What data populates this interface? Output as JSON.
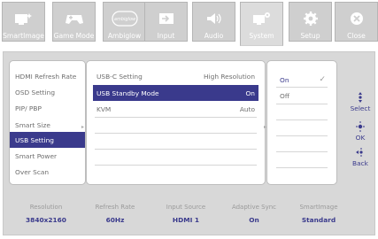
{
  "tabs": [
    {
      "label": "SmartImage",
      "icon": "smartimage-icon"
    },
    {
      "label": "Game Mode",
      "icon": "gamepad-icon"
    },
    {
      "label": "Ambiglow",
      "icon": "ambiglow-icon",
      "badge": "ambiglow"
    },
    {
      "label": "Input",
      "icon": "input-icon"
    },
    {
      "label": "Audio",
      "icon": "speaker-icon"
    },
    {
      "label": "System",
      "icon": "system-icon",
      "active": true
    },
    {
      "label": "Setup",
      "icon": "gear-icon"
    },
    {
      "label": "Close",
      "icon": "close-icon"
    }
  ],
  "menu": {
    "items": [
      "HDMI Refresh Rate",
      "OSD Setting",
      "PIP/ PBP",
      "Smart Size",
      "USB Setting",
      "Smart Power",
      "Over Scan"
    ],
    "selected_index": 4
  },
  "submenu": {
    "items": [
      {
        "label": "USB-C Setting",
        "value": "High Resolution"
      },
      {
        "label": "USB Standby Mode",
        "value": "On"
      },
      {
        "label": "KVM",
        "value": "Auto"
      }
    ],
    "selected_index": 1
  },
  "options": {
    "items": [
      "On",
      "Off"
    ],
    "selected_index": 0
  },
  "hints": {
    "select": "Select",
    "ok": "OK",
    "back": "Back"
  },
  "status": [
    {
      "label": "Resolution",
      "value": "3840x2160"
    },
    {
      "label": "Refresh Rate",
      "value": "60Hz"
    },
    {
      "label": "Input Source",
      "value": "HDMI 1"
    },
    {
      "label": "Adaptive Sync",
      "value": "On"
    },
    {
      "label": "SmartImage",
      "value": "Standard"
    }
  ],
  "colors": {
    "accent": "#3a3a8c",
    "tab_bg": "#cfcfcf",
    "frame_bg": "#d8d8d8"
  }
}
